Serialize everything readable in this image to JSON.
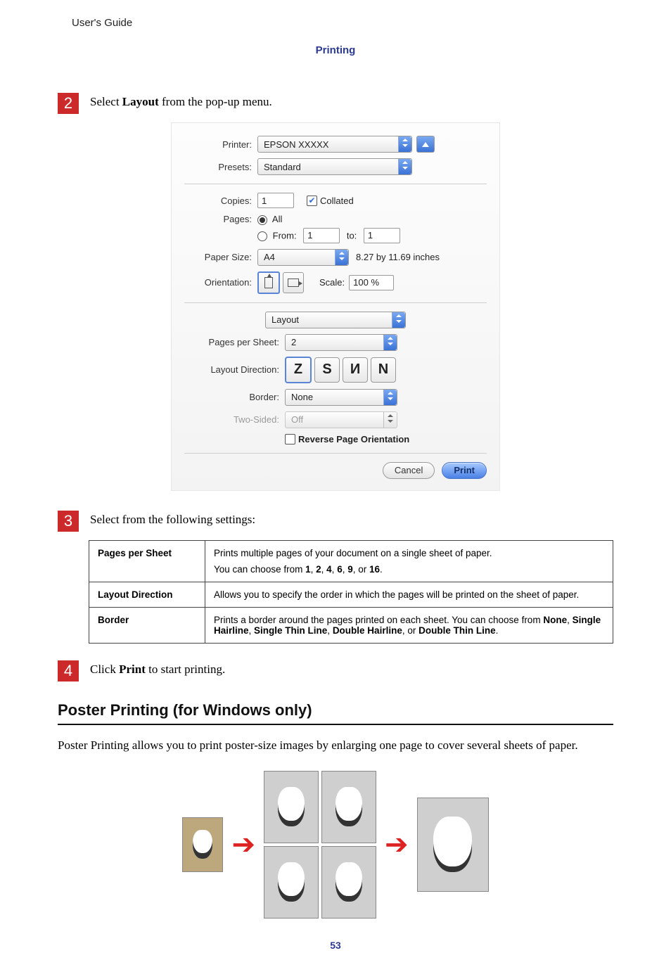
{
  "header": {
    "users_guide": "User's Guide",
    "section": "Printing"
  },
  "step2": {
    "num": "2",
    "text_pre": "Select ",
    "text_bold": "Layout",
    "text_post": " from the pop-up menu."
  },
  "dialog": {
    "printer": {
      "label": "Printer:",
      "value": "EPSON XXXXX"
    },
    "presets": {
      "label": "Presets:",
      "value": "Standard"
    },
    "copies": {
      "label": "Copies:",
      "value": "1",
      "collated": "Collated"
    },
    "pages": {
      "label": "Pages:",
      "all": "All",
      "from_label": "From:",
      "from": "1",
      "to_label": "to:",
      "to": "1"
    },
    "paper_size": {
      "label": "Paper Size:",
      "value": "A4",
      "dims": "8.27 by 11.69 inches"
    },
    "orientation": {
      "label": "Orientation:",
      "scale_label": "Scale:",
      "scale": "100 %"
    },
    "section_dd": "Layout",
    "pps": {
      "label": "Pages per Sheet:",
      "value": "2"
    },
    "layout_dir": {
      "label": "Layout Direction:"
    },
    "border": {
      "label": "Border:",
      "value": "None"
    },
    "two_sided": {
      "label": "Two-Sided:",
      "value": "Off"
    },
    "reverse": "Reverse Page Orientation",
    "cancel": "Cancel",
    "print": "Print"
  },
  "step3": {
    "num": "3",
    "text": "Select from the following settings:"
  },
  "table": {
    "r1h": "Pages per Sheet",
    "r1_l1": "Prints multiple pages of your document on a single sheet of paper.",
    "r1_l2_pre": "You can choose from ",
    "r1_l2_opts": [
      "1",
      "2",
      "4",
      "6",
      "9",
      "16"
    ],
    "r2h": "Layout Direction",
    "r2": "Allows you to specify the order in which the pages will be printed on the sheet of paper.",
    "r3h": "Border",
    "r3_pre": "Prints a border around the pages printed on each sheet. You can choose from ",
    "r3_opts": [
      "None",
      "Single Hairline",
      "Single Thin Line",
      "Double Hairline",
      "Double Thin Line"
    ]
  },
  "step4": {
    "num": "4",
    "text_pre": "Click ",
    "text_bold": "Print",
    "text_post": " to start printing."
  },
  "poster_heading": "Poster Printing (for Windows only)",
  "poster_para": "Poster Printing allows you to print poster-size images by enlarging one page to cover several sheets of paper.",
  "pagenum": "53"
}
